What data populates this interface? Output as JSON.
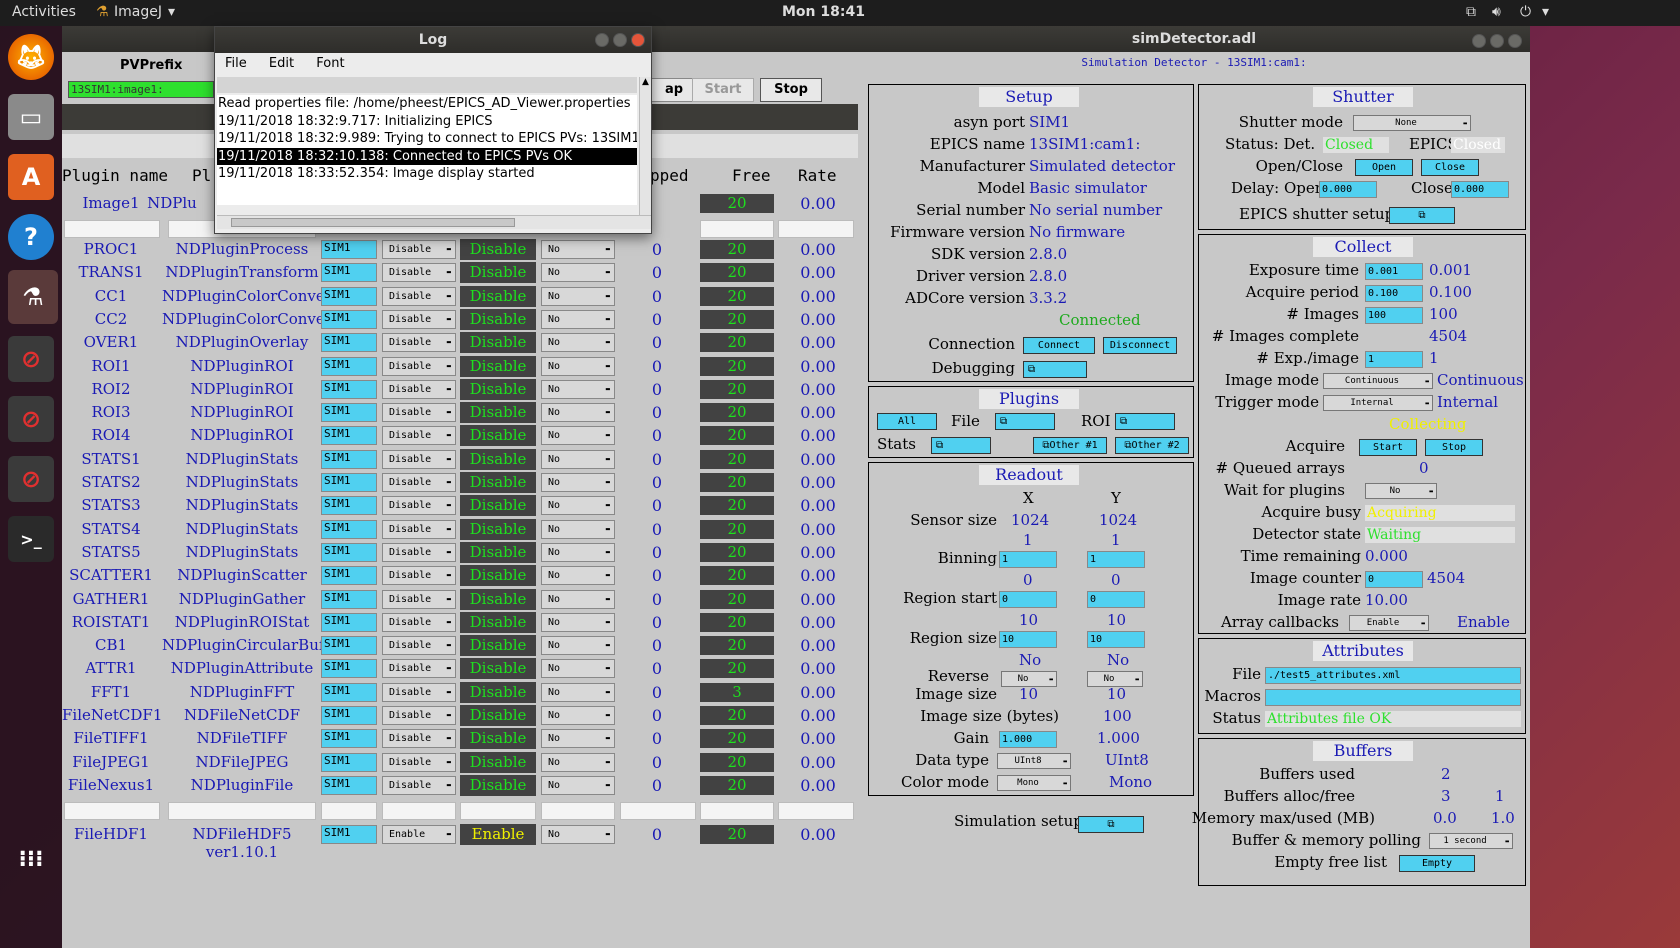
{
  "topbar": {
    "activities": "Activities",
    "app": "ImageJ",
    "clock": "Mon 18:41"
  },
  "pvwin": {
    "prefix_label": "PVPrefix",
    "prefix_value": "13SIM1:image1:",
    "btn_map": "ap",
    "btn_start": "Start",
    "btn_stop": "Stop",
    "headers": {
      "plugin_name": "Plugin name",
      "plugin_type": "Pl",
      "dropped": "pped",
      "free": "Free",
      "rate": "Rate"
    },
    "first_row": {
      "name": "Image1",
      "type": "NDPlu",
      "free": "20",
      "rate": "0.00"
    },
    "rows": [
      {
        "name": "PROC1",
        "type": "NDPluginProcess",
        "port": "SIM1",
        "enable": "Disable",
        "status": "Disable",
        "cb": "No",
        "dropped": "0",
        "free": "20",
        "rate": "0.00"
      },
      {
        "name": "TRANS1",
        "type": "NDPluginTransform",
        "port": "SIM1",
        "enable": "Disable",
        "status": "Disable",
        "cb": "No",
        "dropped": "0",
        "free": "20",
        "rate": "0.00"
      },
      {
        "name": "CC1",
        "type": "NDPluginColorConvert",
        "port": "SIM1",
        "enable": "Disable",
        "status": "Disable",
        "cb": "No",
        "dropped": "0",
        "free": "20",
        "rate": "0.00"
      },
      {
        "name": "CC2",
        "type": "NDPluginColorConvert",
        "port": "SIM1",
        "enable": "Disable",
        "status": "Disable",
        "cb": "No",
        "dropped": "0",
        "free": "20",
        "rate": "0.00"
      },
      {
        "name": "OVER1",
        "type": "NDPluginOverlay",
        "port": "SIM1",
        "enable": "Disable",
        "status": "Disable",
        "cb": "No",
        "dropped": "0",
        "free": "20",
        "rate": "0.00"
      },
      {
        "name": "ROI1",
        "type": "NDPluginROI",
        "port": "SIM1",
        "enable": "Disable",
        "status": "Disable",
        "cb": "No",
        "dropped": "0",
        "free": "20",
        "rate": "0.00"
      },
      {
        "name": "ROI2",
        "type": "NDPluginROI",
        "port": "SIM1",
        "enable": "Disable",
        "status": "Disable",
        "cb": "No",
        "dropped": "0",
        "free": "20",
        "rate": "0.00"
      },
      {
        "name": "ROI3",
        "type": "NDPluginROI",
        "port": "SIM1",
        "enable": "Disable",
        "status": "Disable",
        "cb": "No",
        "dropped": "0",
        "free": "20",
        "rate": "0.00"
      },
      {
        "name": "ROI4",
        "type": "NDPluginROI",
        "port": "SIM1",
        "enable": "Disable",
        "status": "Disable",
        "cb": "No",
        "dropped": "0",
        "free": "20",
        "rate": "0.00"
      },
      {
        "name": "STATS1",
        "type": "NDPluginStats",
        "port": "SIM1",
        "enable": "Disable",
        "status": "Disable",
        "cb": "No",
        "dropped": "0",
        "free": "20",
        "rate": "0.00"
      },
      {
        "name": "STATS2",
        "type": "NDPluginStats",
        "port": "SIM1",
        "enable": "Disable",
        "status": "Disable",
        "cb": "No",
        "dropped": "0",
        "free": "20",
        "rate": "0.00"
      },
      {
        "name": "STATS3",
        "type": "NDPluginStats",
        "port": "SIM1",
        "enable": "Disable",
        "status": "Disable",
        "cb": "No",
        "dropped": "0",
        "free": "20",
        "rate": "0.00"
      },
      {
        "name": "STATS4",
        "type": "NDPluginStats",
        "port": "SIM1",
        "enable": "Disable",
        "status": "Disable",
        "cb": "No",
        "dropped": "0",
        "free": "20",
        "rate": "0.00"
      },
      {
        "name": "STATS5",
        "type": "NDPluginStats",
        "port": "SIM1",
        "enable": "Disable",
        "status": "Disable",
        "cb": "No",
        "dropped": "0",
        "free": "20",
        "rate": "0.00"
      },
      {
        "name": "SCATTER1",
        "type": "NDPluginScatter",
        "port": "SIM1",
        "enable": "Disable",
        "status": "Disable",
        "cb": "No",
        "dropped": "0",
        "free": "20",
        "rate": "0.00"
      },
      {
        "name": "GATHER1",
        "type": "NDPluginGather",
        "port": "SIM1",
        "enable": "Disable",
        "status": "Disable",
        "cb": "No",
        "dropped": "0",
        "free": "20",
        "rate": "0.00"
      },
      {
        "name": "ROISTAT1",
        "type": "NDPluginROIStat",
        "port": "SIM1",
        "enable": "Disable",
        "status": "Disable",
        "cb": "No",
        "dropped": "0",
        "free": "20",
        "rate": "0.00"
      },
      {
        "name": "CB1",
        "type": "NDPluginCircularBuff",
        "port": "SIM1",
        "enable": "Disable",
        "status": "Disable",
        "cb": "No",
        "dropped": "0",
        "free": "20",
        "rate": "0.00"
      },
      {
        "name": "ATTR1",
        "type": "NDPluginAttribute",
        "port": "SIM1",
        "enable": "Disable",
        "status": "Disable",
        "cb": "No",
        "dropped": "0",
        "free": "20",
        "rate": "0.00"
      },
      {
        "name": "FFT1",
        "type": "NDPluginFFT",
        "port": "SIM1",
        "enable": "Disable",
        "status": "Disable",
        "cb": "No",
        "dropped": "0",
        "free": "3",
        "rate": "0.00"
      },
      {
        "name": "FileNetCDF1",
        "type": "NDFileNetCDF",
        "port": "SIM1",
        "enable": "Disable",
        "status": "Disable",
        "cb": "No",
        "dropped": "0",
        "free": "20",
        "rate": "0.00"
      },
      {
        "name": "FileTIFF1",
        "type": "NDFileTIFF",
        "port": "SIM1",
        "enable": "Disable",
        "status": "Disable",
        "cb": "No",
        "dropped": "0",
        "free": "20",
        "rate": "0.00"
      },
      {
        "name": "FileJPEG1",
        "type": "NDFileJPEG",
        "port": "SIM1",
        "enable": "Disable",
        "status": "Disable",
        "cb": "No",
        "dropped": "0",
        "free": "20",
        "rate": "0.00"
      },
      {
        "name": "FileNexus1",
        "type": "NDPluginFile",
        "port": "SIM1",
        "enable": "Disable",
        "status": "Disable",
        "cb": "No",
        "dropped": "0",
        "free": "20",
        "rate": "0.00"
      }
    ],
    "hdf_row": {
      "name": "FileHDF1",
      "type": "NDFileHDF5 ver1.10.1",
      "port": "SIM1",
      "enable": "Enable",
      "status": "Enable",
      "cb": "No",
      "dropped": "0",
      "free": "20",
      "rate": "0.00"
    }
  },
  "log": {
    "title": "Log",
    "menu": [
      "File",
      "Edit",
      "Font"
    ],
    "lines": [
      "Read properties file: /home/pheest/EPICS_AD_Viewer.properties",
      "19/11/2018 18:32:9.717: Initializing EPICS",
      "19/11/2018 18:32:9.989: Trying to connect to EPICS PVs: 13SIM1",
      "19/11/2018 18:32:10.138: Connected to EPICS PVs OK",
      "19/11/2018 18:33:52.354: Image display started"
    ]
  },
  "sim": {
    "title": "simDetector.adl",
    "subtitle": "Simulation Detector - 13SIM1:cam1:",
    "setup": {
      "head": "Setup",
      "asyn_port_label": "asyn port",
      "asyn_port": "SIM1",
      "epics_name_label": "EPICS name",
      "epics_name": "13SIM1:cam1:",
      "manufacturer_label": "Manufacturer",
      "manufacturer": "Simulated detector",
      "model_label": "Model",
      "model": "Basic simulator",
      "serial_label": "Serial number",
      "serial": "No serial number",
      "firmware_label": "Firmware version",
      "firmware": "No firmware",
      "sdk_label": "SDK version",
      "sdk": "2.8.0",
      "driver_label": "Driver version",
      "driver": "2.8.0",
      "adcore_label": "ADCore version",
      "adcore": "3.3.2",
      "connected": "Connected",
      "connection_label": "Connection",
      "connect_btn": "Connect",
      "disconnect_btn": "Disconnect",
      "debugging_label": "Debugging"
    },
    "plugins": {
      "head": "Plugins",
      "all": "All",
      "file_label": "File",
      "roi_label": "ROI",
      "stats_label": "Stats",
      "other1": "Other #1",
      "other2": "Other #2"
    },
    "readout": {
      "head": "Readout",
      "x": "X",
      "y": "Y",
      "sensor_label": "Sensor size",
      "sensor_x": "1024",
      "sensor_y": "1024",
      "binning_label": "Binning",
      "bin_x_rb": "1",
      "bin_y_rb": "1",
      "bin_x": "1",
      "bin_y": "1",
      "start_label": "Region start",
      "start_x_rb": "0",
      "start_y_rb": "0",
      "start_x": "0",
      "start_y": "0",
      "size_label": "Region size",
      "size_x_rb": "10",
      "size_y_rb": "10",
      "size_x": "10",
      "size_y": "10",
      "reverse_label": "Reverse",
      "rev_x_rb": "No",
      "rev_y_rb": "No",
      "rev_x": "No",
      "rev_y": "No",
      "imgsize_label": "Image size",
      "imgsize_x": "10",
      "imgsize_y": "10",
      "bytes_label": "Image size (bytes)",
      "bytes": "100",
      "gain_label": "Gain",
      "gain_in": "1.000",
      "gain": "1.000",
      "dtype_label": "Data type",
      "dtype_in": "UInt8",
      "dtype": "UInt8",
      "color_label": "Color mode",
      "color_in": "Mono",
      "color": "Mono"
    },
    "sim_setup_label": "Simulation setup",
    "shutter": {
      "head": "Shutter",
      "mode_label": "Shutter mode",
      "mode": "None",
      "status_label": "Status: Det.",
      "det": "Closed",
      "epics_label": "EPICS",
      "epics": "Closed",
      "openclose_label": "Open/Close",
      "open": "Open",
      "close": "Close",
      "delay_label": "Delay: Open",
      "delay_open": "0.000",
      "close_label": "Close",
      "delay_close": "0.000",
      "setup_label": "EPICS shutter setup"
    },
    "collect": {
      "head": "Collect",
      "exp_label": "Exposure time",
      "exp_in": "0.001",
      "exp": "0.001",
      "period_label": "Acquire period",
      "period_in": "0.100",
      "period": "0.100",
      "nimg_label": "# Images",
      "nimg_in": "100",
      "nimg": "100",
      "complete_label": "# Images complete",
      "complete": "4504",
      "nexp_label": "# Exp./image",
      "nexp_in": "1",
      "nexp": "1",
      "imode_label": "Image mode",
      "imode_in": "Continuous",
      "imode": "Continuous",
      "tmode_label": "Trigger mode",
      "tmode_in": "Internal",
      "tmode": "Internal",
      "collecting": "Collecting",
      "acquire_label": "Acquire",
      "start": "Start",
      "stop": "Stop",
      "queued_label": "# Queued arrays",
      "queued": "0",
      "wait_label": "Wait for plugins",
      "wait": "No",
      "busy_label": "Acquire busy",
      "busy": "Acquiring",
      "state_label": "Detector state",
      "state": "Waiting",
      "remaining_label": "Time remaining",
      "remaining": "0.000",
      "counter_label": "Image counter",
      "counter_in": "0",
      "counter": "4504",
      "rate_label": "Image rate",
      "rate": "10.00",
      "callbacks_label": "Array callbacks",
      "callbacks_in": "Enable",
      "callbacks": "Enable"
    },
    "attributes": {
      "head": "Attributes",
      "file_label": "File",
      "file": "./test5_attributes.xml",
      "macros_label": "Macros",
      "macros": "",
      "status_label": "Status",
      "status": "Attributes file OK"
    },
    "buffers": {
      "head": "Buffers",
      "used_label": "Buffers used",
      "used": "2",
      "alloc_label": "Buffers alloc/free",
      "alloc": "3",
      "free": "1",
      "mem_label": "Memory max/used (MB)",
      "mem_max": "0.0",
      "mem_used": "1.0",
      "poll_label": "Buffer & memory polling",
      "poll": "1 second",
      "empty_label": "Empty free list",
      "empty": "Empty"
    }
  },
  "colors": {
    "accent_blue": "#1a1ab4",
    "input_cyan": "#50d0f0",
    "led_green": "#1ee01e",
    "panel_gray": "#c8c8c8"
  }
}
